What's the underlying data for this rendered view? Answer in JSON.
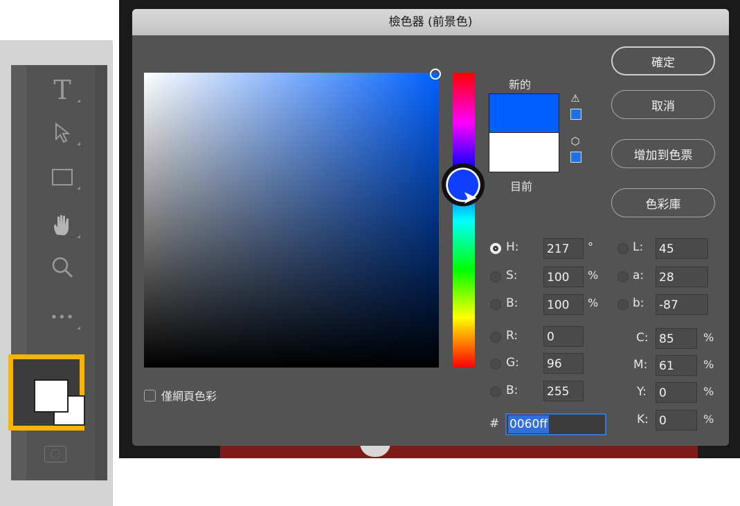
{
  "dialog": {
    "title": "檢色器 (前景色)",
    "buttons": {
      "ok": "確定",
      "cancel": "取消",
      "add_swatch": "增加到色票",
      "libraries": "色彩庫"
    },
    "swatch_labels": {
      "new": "新的",
      "current": "目前"
    },
    "new_color": "#0060ff",
    "current_color": "#ffffff",
    "web_only_label": "僅網頁色彩",
    "web_only_checked": false,
    "fields": {
      "H": {
        "label": "H:",
        "value": "217",
        "unit": "°",
        "selected": true
      },
      "S": {
        "label": "S:",
        "value": "100",
        "unit": "%"
      },
      "Bri": {
        "label": "B:",
        "value": "100",
        "unit": "%"
      },
      "R": {
        "label": "R:",
        "value": "0"
      },
      "G": {
        "label": "G:",
        "value": "96"
      },
      "Blue": {
        "label": "B:",
        "value": "255"
      },
      "L": {
        "label": "L:",
        "value": "45"
      },
      "a": {
        "label": "a:",
        "value": "28"
      },
      "b": {
        "label": "b:",
        "value": "-87"
      },
      "C": {
        "label": "C:",
        "value": "85",
        "unit": "%"
      },
      "M": {
        "label": "M:",
        "value": "61",
        "unit": "%"
      },
      "Y": {
        "label": "Y:",
        "value": "0",
        "unit": "%"
      },
      "K": {
        "label": "K:",
        "value": "0",
        "unit": "%"
      }
    },
    "hex_label": "#",
    "hex_value": "0060ff"
  },
  "toolbar": {
    "tools": [
      "type-tool",
      "path-selection-tool",
      "rectangle-tool",
      "hand-tool",
      "zoom-tool",
      "more-tools"
    ],
    "icons": {
      "type": "T",
      "select": "▶",
      "rect": "▭",
      "hand": "✋",
      "zoom": "🔍",
      "more": "•••"
    },
    "colors": {
      "foreground": "#ffffff",
      "background": "#ffffff",
      "highlight": "#f7b500"
    }
  }
}
